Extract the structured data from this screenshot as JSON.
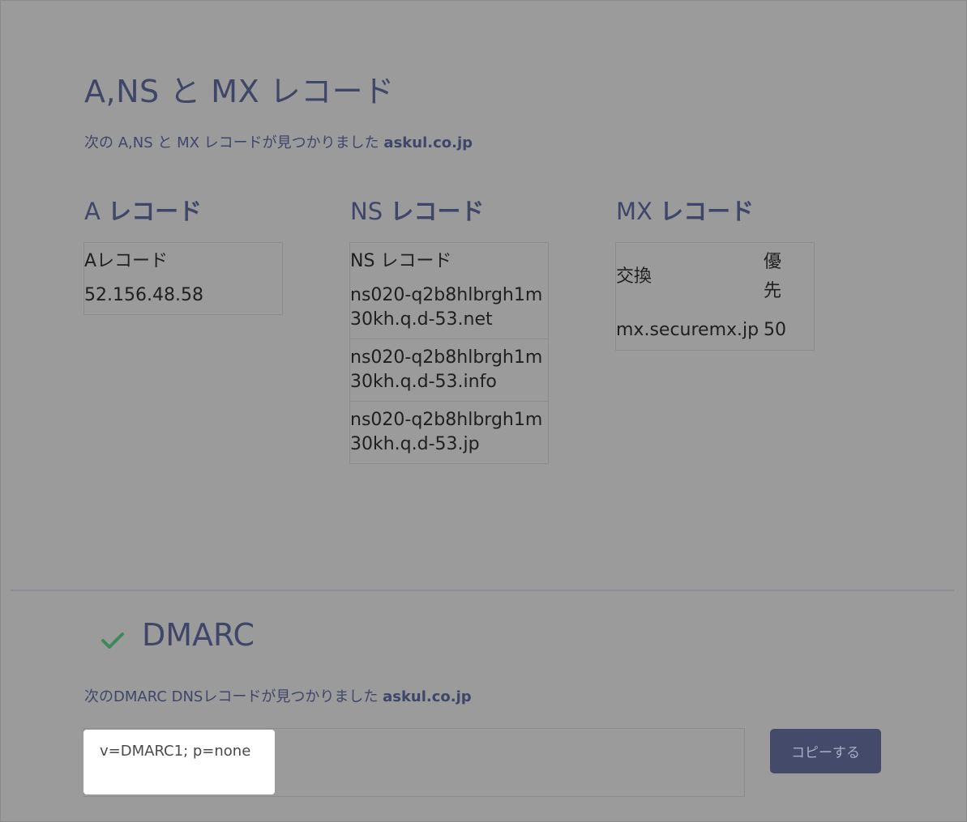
{
  "records_section": {
    "title": "A,NS と MX レコード",
    "intro_text": "次の A,NS と MX レコードが見つかりました",
    "domain": "askul.co.jp"
  },
  "a_records": {
    "title_prefix": "A",
    "title_suffix": "レコード",
    "header": "Aレコード",
    "values": [
      "52.156.48.58"
    ]
  },
  "ns_records": {
    "title_prefix": "NS",
    "title_suffix": "レコード",
    "header": "NS レコード",
    "values": [
      "ns020-q2b8hlbrgh1m30kh.q.d-53.net",
      "ns020-q2b8hlbrgh1m30kh.q.d-53.info",
      "ns020-q2b8hlbrgh1m30kh.q.d-53.jp"
    ]
  },
  "mx_records": {
    "title_prefix": "MX",
    "title_suffix": "レコード",
    "header_exchange": "交換",
    "header_priority": "優先",
    "rows": [
      {
        "exchange": "mx.securemx.jp",
        "priority": "50"
      }
    ]
  },
  "dmarc": {
    "title": "DMARC",
    "status_icon": "check-icon",
    "status_color": "#3a8a5c",
    "intro_text": "次のDMARC DNSレコードが見つかりました",
    "domain": "askul.co.jp",
    "record_value": "v=DMARC1; p=none",
    "copy_label": "コピーする"
  },
  "colors": {
    "heading": "#3f4668",
    "background_overlay": "#9b9b9b",
    "button": "#434a6a"
  }
}
